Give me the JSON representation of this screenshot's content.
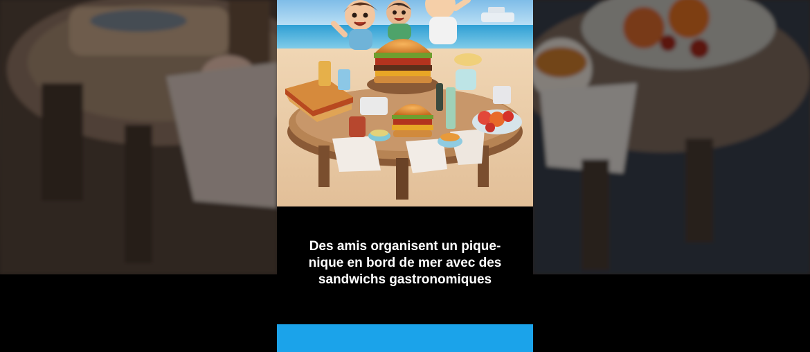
{
  "caption": {
    "line1": "Des amis organisent un pique-",
    "line2": "nique en bord de mer avec des",
    "line3": "sandwichs gastronomiques"
  },
  "colors": {
    "page_background": "#000000",
    "accent_bar": "#1ba3ea",
    "caption_text": "#ffffff"
  },
  "artwork": {
    "icon": "beach-picnic-illustration"
  }
}
